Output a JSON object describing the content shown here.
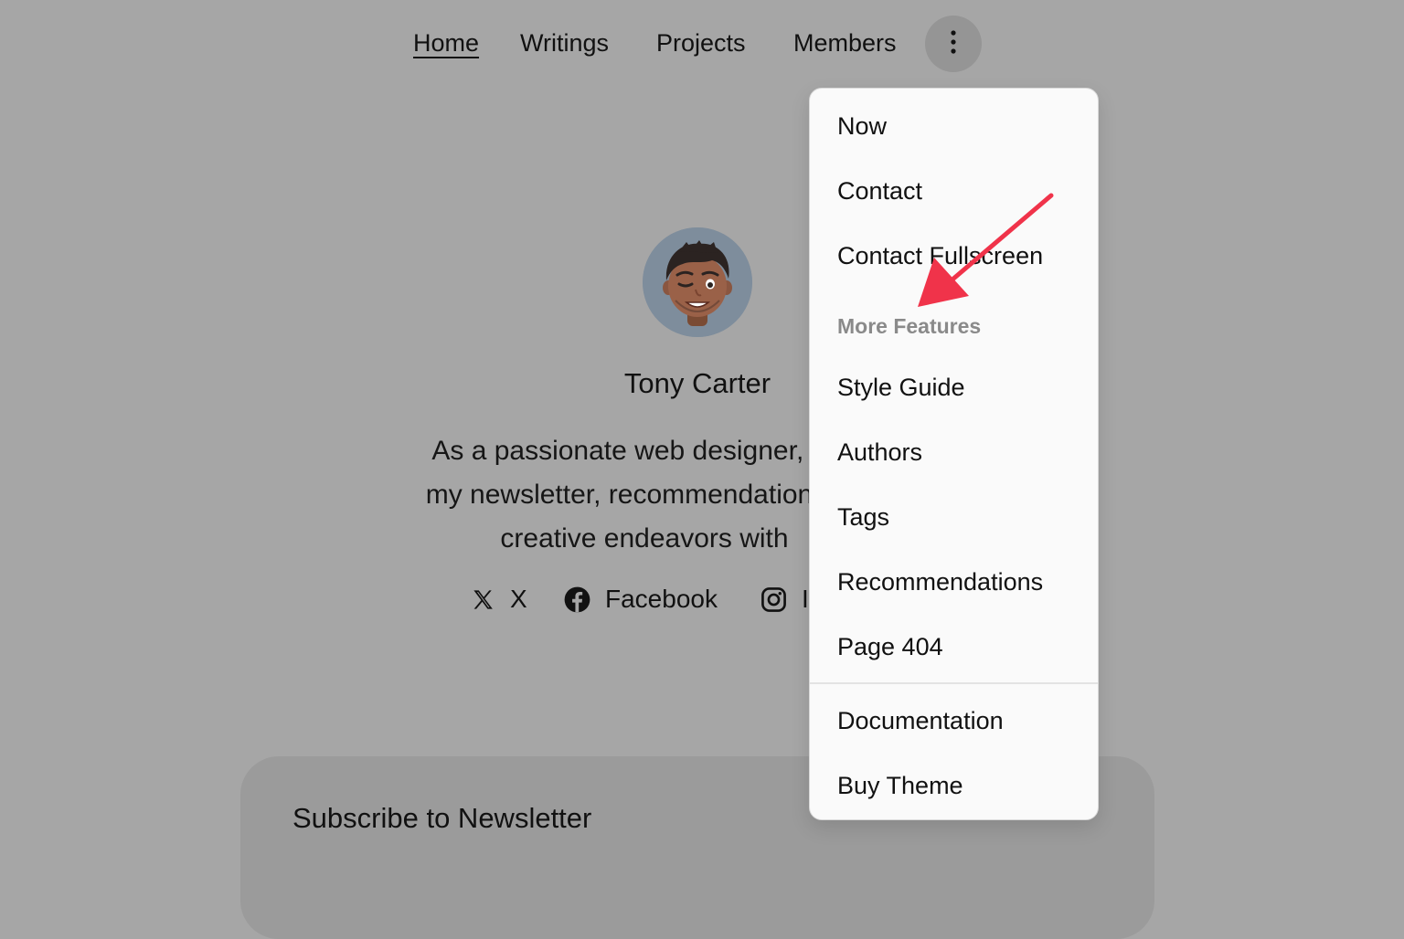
{
  "nav": {
    "links": [
      {
        "label": "Home",
        "active": true
      },
      {
        "label": "Writings"
      },
      {
        "label": "Projects"
      },
      {
        "label": "Members"
      }
    ],
    "more_icon": "more-vertical-icon"
  },
  "profile": {
    "name": "Tony Carter",
    "bio_lines": [
      "As a passionate web designer, I an",
      "my newsletter, recommendations, la",
      "creative endeavors with"
    ]
  },
  "social": [
    {
      "icon": "x-logo-icon",
      "label": "X"
    },
    {
      "icon": "facebook-icon",
      "label": "Facebook"
    },
    {
      "icon": "instagram-icon",
      "label": "I"
    }
  ],
  "newsletter": {
    "title": "Subscribe to Newsletter"
  },
  "dropdown": {
    "items": [
      "Now",
      "Contact",
      "Contact Fullscreen"
    ],
    "section_heading": "More Features",
    "feature_items": [
      "Style Guide",
      "Authors",
      "Tags",
      "Recommendations",
      "Page 404"
    ],
    "footer_items": [
      "Documentation",
      "Buy Theme"
    ]
  },
  "colors": {
    "page_overlay": "#a6a6a6",
    "dropdown_bg": "#fafafa",
    "heading_gray": "#8a8a8a",
    "arrow_red": "#f0334a"
  }
}
